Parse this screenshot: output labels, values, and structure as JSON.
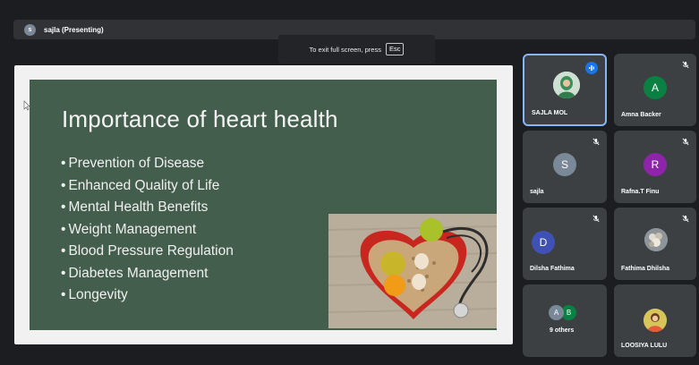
{
  "presenter_bar": {
    "avatar_letter": "s",
    "label": "sajla (Presenting)"
  },
  "fullscreen_toast": {
    "text": "To exit full screen, press",
    "key": "Esc"
  },
  "slide": {
    "title": "Importance of heart health",
    "bullets": [
      "Prevention of Disease",
      "Enhanced Quality of Life",
      "Mental Health Benefits",
      "Weight Management",
      "Blood Pressure Regulation",
      "Diabetes Management",
      "Longevity"
    ],
    "board_color": "#435e4c"
  },
  "participants": [
    {
      "name": "SAJLA MOL",
      "avatar": "photo",
      "speaking": true
    },
    {
      "name": "Amna Backer",
      "avatar_letter": "A",
      "avatar_color": "#0b8043",
      "muted": true
    },
    {
      "name": "sajla",
      "avatar_letter": "S",
      "avatar_color": "#7a8898",
      "muted": true
    },
    {
      "name": "Rafna.T Finu",
      "avatar_letter": "R",
      "avatar_color": "#8e24aa",
      "muted": true
    },
    {
      "name": "Dilsha Fathima",
      "avatar_letter": "D",
      "avatar_color": "#3f51b5",
      "muted": true
    },
    {
      "name": "Fathima Dhilsha",
      "avatar": "photo",
      "muted": true
    },
    {
      "name": "9 others",
      "avatar_letters": [
        "A",
        "B"
      ],
      "avatar_colors": [
        "#7a8898",
        "#0b8043"
      ]
    },
    {
      "name": "LOOSIYA LULU",
      "avatar": "photo"
    }
  ],
  "colors": {
    "accent": "#8ab4f8",
    "speaking": "#1a73e8",
    "tile": "#3c4043",
    "background": "#1c1d20"
  }
}
